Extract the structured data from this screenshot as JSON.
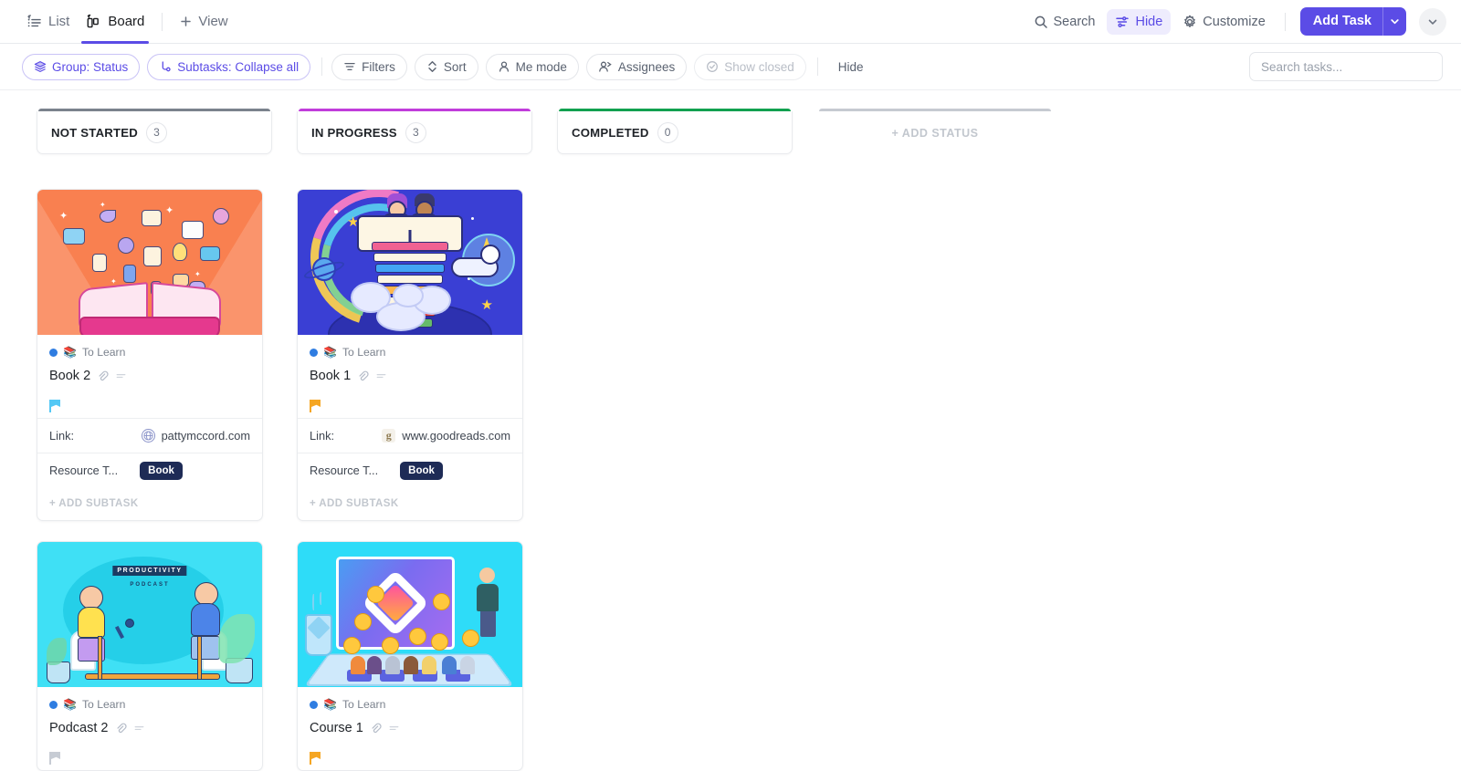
{
  "topbar": {
    "views": [
      {
        "label": "List",
        "icon": "list-view-icon",
        "active": false
      },
      {
        "label": "Board",
        "icon": "board-view-icon",
        "active": true
      }
    ],
    "add_view_label": "View",
    "actions": [
      {
        "label": "Search",
        "icon": "search-icon",
        "highlighted": false
      },
      {
        "label": "Hide",
        "icon": "sliders-icon",
        "highlighted": true
      },
      {
        "label": "Customize",
        "icon": "gear-icon",
        "highlighted": false
      }
    ],
    "add_task_label": "Add Task"
  },
  "filterbar": {
    "chips": [
      {
        "label": "Group: Status",
        "icon": "layers-icon",
        "style": "purple"
      },
      {
        "label": "Subtasks: Collapse all",
        "icon": "subtask-icon",
        "style": "purple"
      },
      {
        "label": "Filters",
        "icon": "filter-icon",
        "style": "default"
      },
      {
        "label": "Sort",
        "icon": "sort-icon",
        "style": "default"
      },
      {
        "label": "Me mode",
        "icon": "person-icon",
        "style": "default"
      },
      {
        "label": "Assignees",
        "icon": "people-icon",
        "style": "default"
      },
      {
        "label": "Show closed",
        "icon": "check-circle-icon",
        "style": "muted"
      }
    ],
    "hide_label": "Hide",
    "search_placeholder": "Search tasks..."
  },
  "board": {
    "add_status_label": "+ ADD STATUS",
    "add_subtask_label": "+ ADD SUBTASK",
    "columns": [
      {
        "title": "NOT STARTED",
        "count": "3",
        "color": "#7b828d",
        "cards": [
          {
            "list_name": "To Learn",
            "status_color": "#2f7de1",
            "title": "Book 2",
            "cover": "book2",
            "flag_color": "#54c8f5",
            "fields": [
              {
                "label": "Link:",
                "type": "link",
                "value": "pattymccord.com",
                "favicon": "globe-icon"
              },
              {
                "label": "Resource T...",
                "type": "tag",
                "value": "Book",
                "tag_color": "#1e2b56"
              }
            ]
          },
          {
            "list_name": "To Learn",
            "status_color": "#2f7de1",
            "title": "Podcast 2",
            "cover": "podcast",
            "flag_color": "#c7ccd4",
            "fields": []
          }
        ]
      },
      {
        "title": "IN PROGRESS",
        "count": "3",
        "color": "#c13ddb",
        "cards": [
          {
            "list_name": "To Learn",
            "status_color": "#2f7de1",
            "title": "Book 1",
            "cover": "book1",
            "flag_color": "#f5a623",
            "fields": [
              {
                "label": "Link:",
                "type": "link",
                "value": "www.goodreads.com",
                "favicon": "goodreads-icon"
              },
              {
                "label": "Resource T...",
                "type": "tag",
                "value": "Book",
                "tag_color": "#1e2b56"
              }
            ]
          },
          {
            "list_name": "To Learn",
            "status_color": "#2f7de1",
            "title": "Course 1",
            "cover": "course",
            "flag_color": "#f5a623",
            "fields": []
          }
        ]
      },
      {
        "title": "COMPLETED",
        "count": "0",
        "color": "#12a150",
        "cards": []
      }
    ]
  },
  "colors": {
    "accent": "#5b4ce6",
    "accent_soft": "#eeecfd",
    "border": "#e9ebee",
    "text": "#1f2328",
    "muted": "#7b828d"
  }
}
